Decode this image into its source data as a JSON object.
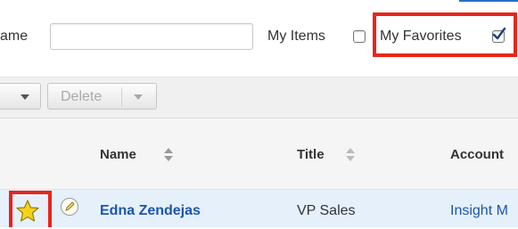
{
  "filter": {
    "name_label": "ame",
    "name_value": "",
    "my_items_label": "My Items",
    "my_items_checked": false,
    "my_favorites_label": "My Favorites",
    "my_favorites_checked": true
  },
  "toolbar": {
    "delete_label": "Delete"
  },
  "columns": {
    "name": "Name",
    "title": "Title",
    "account": "Account"
  },
  "row": {
    "name": "Edna Zendejas",
    "title": "VP Sales",
    "account": "Insight M",
    "favorited": true
  },
  "colors": {
    "highlight": "#e8251b",
    "link": "#1a55b2",
    "row_bg": "#e6f0fb"
  },
  "icons": [
    "caret-down-icon",
    "sort-icon",
    "star-icon",
    "pencil-icon",
    "checkbox-icon"
  ]
}
